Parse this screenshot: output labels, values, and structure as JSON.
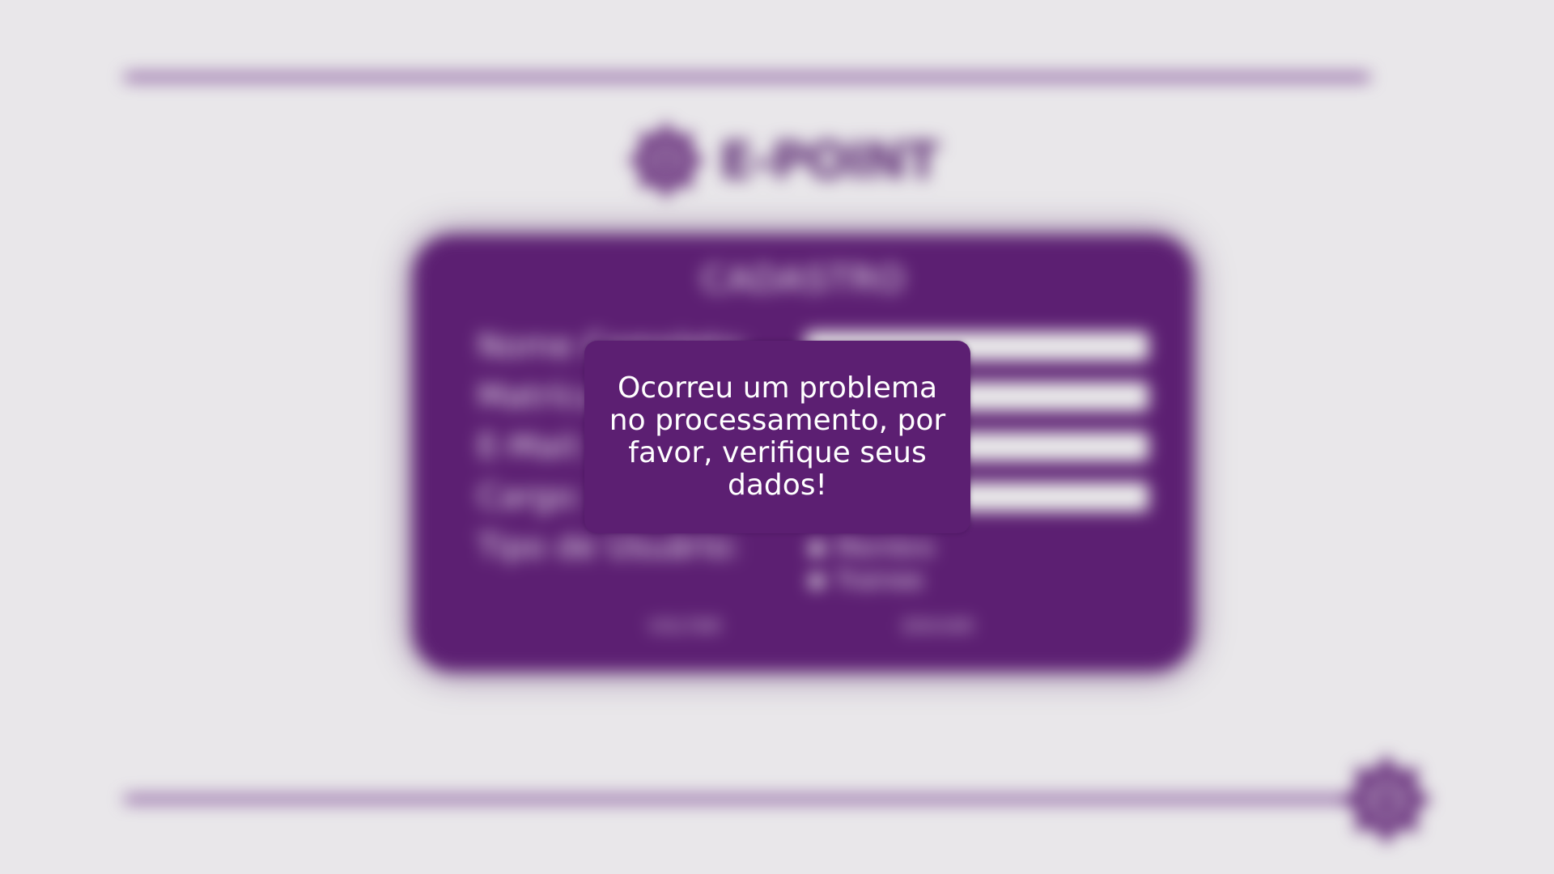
{
  "brand": {
    "name": "E-POINT",
    "color": "#5c1f72"
  },
  "form": {
    "title": "CADASTRO",
    "labels": {
      "nome": "Nome Completo:",
      "matricula": "Matrícula:",
      "email": "E-Mail:",
      "cargo": "Cargo:",
      "tipo": "Tipo de Usuário:"
    },
    "user_types": [
      "Membro",
      "Trainee"
    ],
    "buttons": {
      "back": "VOLTAR",
      "submit": "ENVIAR"
    }
  },
  "dialog": {
    "message": "Ocorreu um problema no processamento, por favor, verifique seus dados!"
  },
  "icons": {
    "logo": "gear-e-icon"
  }
}
